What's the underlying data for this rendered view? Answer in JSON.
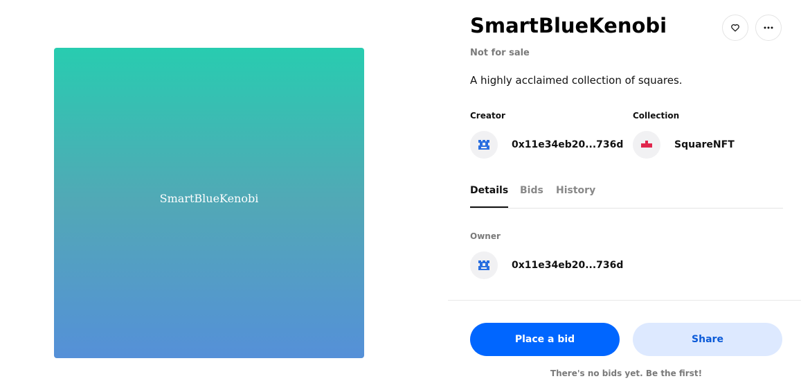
{
  "artwork": {
    "label": "SmartBlueKenobi"
  },
  "item": {
    "title": "SmartBlueKenobi",
    "sale_status": "Not for sale",
    "description": "A highly acclaimed collection of squares."
  },
  "actions": {
    "like_icon": "heart-icon",
    "more_icon": "more-icon"
  },
  "creator": {
    "label": "Creator",
    "address": "0x11e34eb20...736d",
    "avatar_color": "#2a6fe0"
  },
  "collection": {
    "label": "Collection",
    "name": "SquareNFT",
    "avatar_color": "#e0264d"
  },
  "tabs": [
    {
      "label": "Details",
      "active": true
    },
    {
      "label": "Bids",
      "active": false
    },
    {
      "label": "History",
      "active": false
    }
  ],
  "owner": {
    "label": "Owner",
    "address": "0x11e34eb20...736d"
  },
  "buttons": {
    "place_bid": "Place a bid",
    "share": "Share"
  },
  "footer": {
    "no_bids_text": "There's no bids yet. Be the first!"
  },
  "colors": {
    "accent": "#0066ff",
    "accent_light": "#dde9ff",
    "gradient_top": "#28ccb0",
    "gradient_bottom": "#5590d8"
  }
}
